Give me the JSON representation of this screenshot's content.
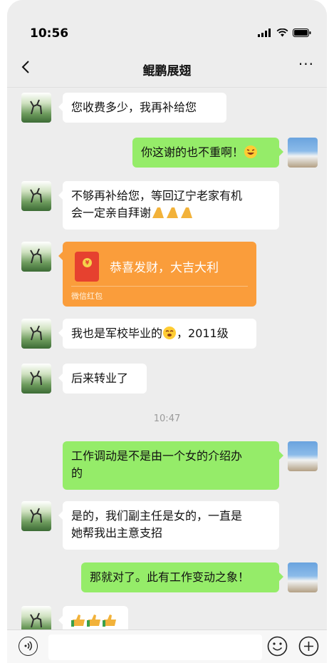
{
  "status_bar": {
    "time": "10:56",
    "icons": [
      "signal-icon",
      "wifi-icon",
      "battery-icon"
    ]
  },
  "nav": {
    "title": "鲲鹏展翅",
    "back_icon": "chevron-left-icon",
    "more_label": "···"
  },
  "messages": [
    {
      "side": "left",
      "type": "text",
      "text": "您收费多少，我再补给您"
    },
    {
      "side": "right",
      "type": "text",
      "text": "你这谢的也不重啊！",
      "emoji": "laughing-face-emoji"
    },
    {
      "side": "left",
      "type": "text",
      "text_line1": "不够再补给您，等回辽宁老家有机",
      "text_line2": "会一定亲自拜谢",
      "emoji": "folded-hands-emoji x3"
    },
    {
      "side": "left",
      "type": "red_packet",
      "text": "恭喜发财，大吉大利",
      "label": "微信红包"
    },
    {
      "side": "left",
      "type": "text",
      "text_before": "我也是军校毕业的",
      "emoji": "yawning-face-emoji",
      "text_after": "，2011级"
    },
    {
      "side": "left",
      "type": "text",
      "text": "后来转业了"
    },
    {
      "side": "right",
      "type": "text",
      "text_line1": "工作调动是不是由一个女的介绍办",
      "text_line2": "的"
    },
    {
      "side": "left",
      "type": "text",
      "text_line1": "是的，我们副主任是女的，一直是",
      "text_line2": "她帮我出主意支招"
    },
    {
      "side": "right",
      "type": "text",
      "text": "那就对了。此有工作变动之象！"
    },
    {
      "side": "left",
      "type": "emoji_only",
      "emoji": "thumbs-up-emoji x3"
    }
  ],
  "timestamp": "10:47",
  "input_bar": {
    "voice_icon": "voice-icon",
    "emoji_icon": "smiley-icon",
    "plus_icon": "plus-icon",
    "placeholder": ""
  },
  "colors": {
    "background": "#ededed",
    "sent_bubble": "#95ec69",
    "received_bubble": "#ffffff",
    "red_packet": "#fa9d3b"
  }
}
